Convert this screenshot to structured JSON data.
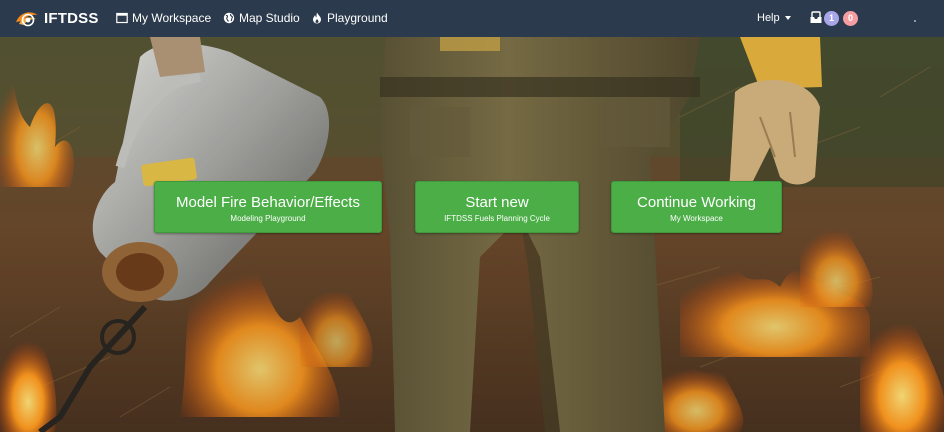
{
  "navbar": {
    "brand": "IFTDSS",
    "links": [
      {
        "label": "My Workspace",
        "icon": "window-icon"
      },
      {
        "label": "Map Studio",
        "icon": "globe-icon"
      },
      {
        "label": "Playground",
        "icon": "fire-icon"
      }
    ],
    "help": "Help",
    "badges": {
      "primary": "1",
      "alert": "0"
    }
  },
  "actions": [
    {
      "title": "Model Fire Behavior/Effects",
      "subtitle": "Modeling Playground"
    },
    {
      "title": "Start new",
      "subtitle": "IFTDSS Fuels Planning Cycle"
    },
    {
      "title": "Continue Working",
      "subtitle": "My Workspace"
    }
  ],
  "colors": {
    "navbar": "#2b3a4c",
    "button_green": "#4bae47",
    "badge_blue": "#a8a6e8",
    "badge_red": "#f59da0"
  }
}
